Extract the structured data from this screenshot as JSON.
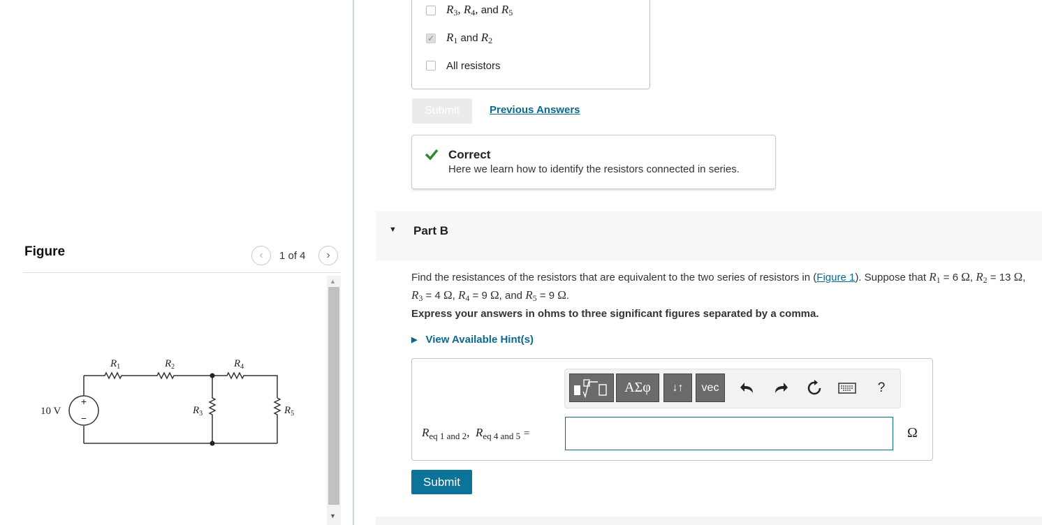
{
  "figure_panel": {
    "title": "Figure",
    "page_indicator": "1 of 4",
    "circuit": {
      "source_label": "10 V",
      "plus": "+",
      "minus": "−",
      "r1": "R",
      "r1_sub": "1",
      "r2": "R",
      "r2_sub": "2",
      "r3": "R",
      "r3_sub": "3",
      "r4": "R",
      "r4_sub": "4",
      "r5": "R",
      "r5_sub": "5"
    }
  },
  "part_a": {
    "options": [
      {
        "label_html": "R3, R4, and R5",
        "checked": false
      },
      {
        "label_html": "R1 and R2",
        "checked": true
      },
      {
        "label_html": "All resistors",
        "checked": false
      }
    ],
    "submit_label": "Submit",
    "previous_answers_label": "Previous Answers",
    "feedback_title": "Correct",
    "feedback_message": "Here we learn how to identify the resistors connected in series."
  },
  "part_b": {
    "title": "Part B",
    "question_prefix": "Find the resistances of the resistors that are equivalent to the two series of resistors in (",
    "figure_link": "Figure 1",
    "question_suffix": "). Suppose that",
    "values": {
      "r1": "6",
      "r2": "13",
      "r3": "4",
      "r4": "9",
      "r5": "9",
      "unit": "Ω"
    },
    "instruction": "Express your answers in ohms to three significant figures separated by a comma.",
    "hints_label": "View Available Hint(s)",
    "toolbar": {
      "templates_icon": "templates-icon",
      "greek_label": "ΑΣφ",
      "arrows_label": "↓↑",
      "vec_label": "vec",
      "undo_icon": "undo-icon",
      "redo_icon": "redo-icon",
      "reset_icon": "reset-icon",
      "keyboard_icon": "keyboard-icon",
      "help_label": "?"
    },
    "answer_label_r": "R",
    "answer_sub_1": "eq 1 and 2",
    "answer_sub_2": "eq 4 and 5",
    "answer_value": "",
    "unit": "Ω",
    "submit_label": "Submit"
  }
}
